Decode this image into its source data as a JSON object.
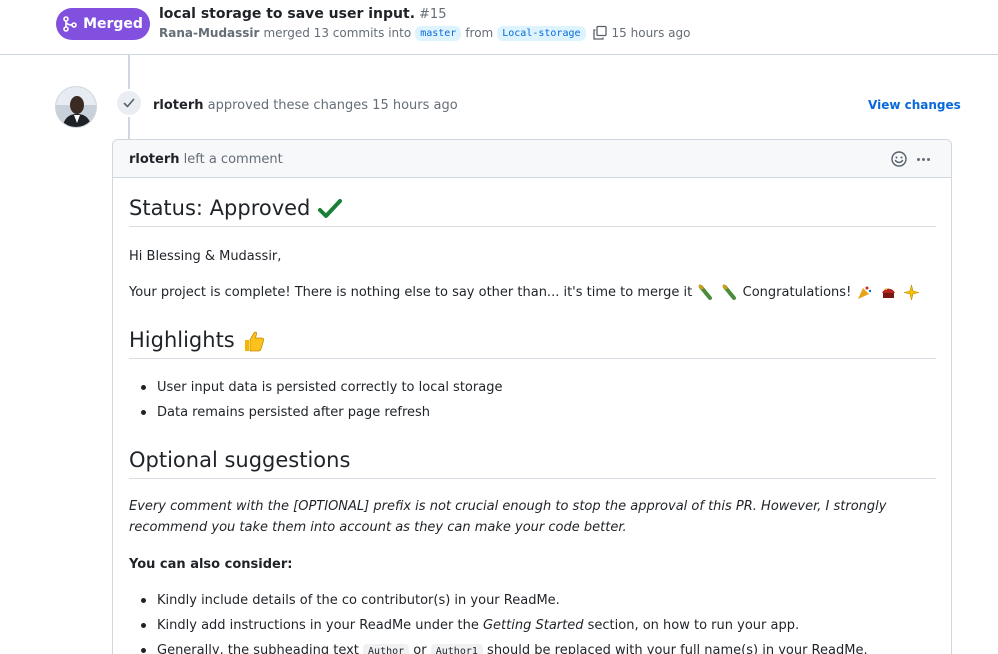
{
  "pr": {
    "state_label": "Merged",
    "title": "local storage to save user input.",
    "number": "#15",
    "author": "Rana-Mudassir",
    "merge_text": "merged 13 commits into",
    "base_branch": "master",
    "from_text": "from",
    "head_branch": "Local-storage",
    "time": "15 hours ago"
  },
  "review": {
    "reviewer": "rloterh",
    "action_text": "approved these changes 15 hours ago",
    "view_changes_label": "View changes"
  },
  "comment": {
    "author": "rloterh",
    "action_text": "left a comment",
    "status_heading": "Status: Approved",
    "greeting": "Hi Blessing & Mudassir,",
    "complete_text": "Your project is complete! There is nothing else to say other than... it's time to merge it",
    "congrats_text": "Congratulations!",
    "highlights_heading": "Highlights",
    "highlights": [
      "User input data is persisted correctly to local storage",
      "Data remains persisted after page refresh"
    ],
    "optional_heading": "Optional suggestions",
    "optional_note": "Every comment with the [OPTIONAL] prefix is not crucial enough to stop the approval of this PR. However, I strongly recommend you take them into account as they can make your code better.",
    "consider_label": "You can also consider:",
    "suggestion_1": "Kindly include details of the co contributor(s) in your ReadMe.",
    "suggestion_2_a": "Kindly add instructions in your ReadMe under the",
    "suggestion_2_em": "Getting Started",
    "suggestion_2_b": "section, on how to run your app.",
    "suggestion_3_a": "Generally, the subheading text",
    "suggestion_3_code1": "Author",
    "suggestion_3_or": "or",
    "suggestion_3_code2": "Author1",
    "suggestion_3_b": "should be replaced with your full name(s) in your ReadMe."
  },
  "colors": {
    "merged_purple": "#8250df",
    "link_blue": "#0969da",
    "check_green": "#1a7f37"
  },
  "icons": [
    "git-merge-icon",
    "copy-icon",
    "check-icon",
    "smiley-icon",
    "kebab-icon",
    "heavy-check-mark-emoji",
    "thumbs-up-emoji",
    "champagne-emoji",
    "party-popper-emoji",
    "confetti-ball-emoji",
    "sparkle-emoji"
  ]
}
